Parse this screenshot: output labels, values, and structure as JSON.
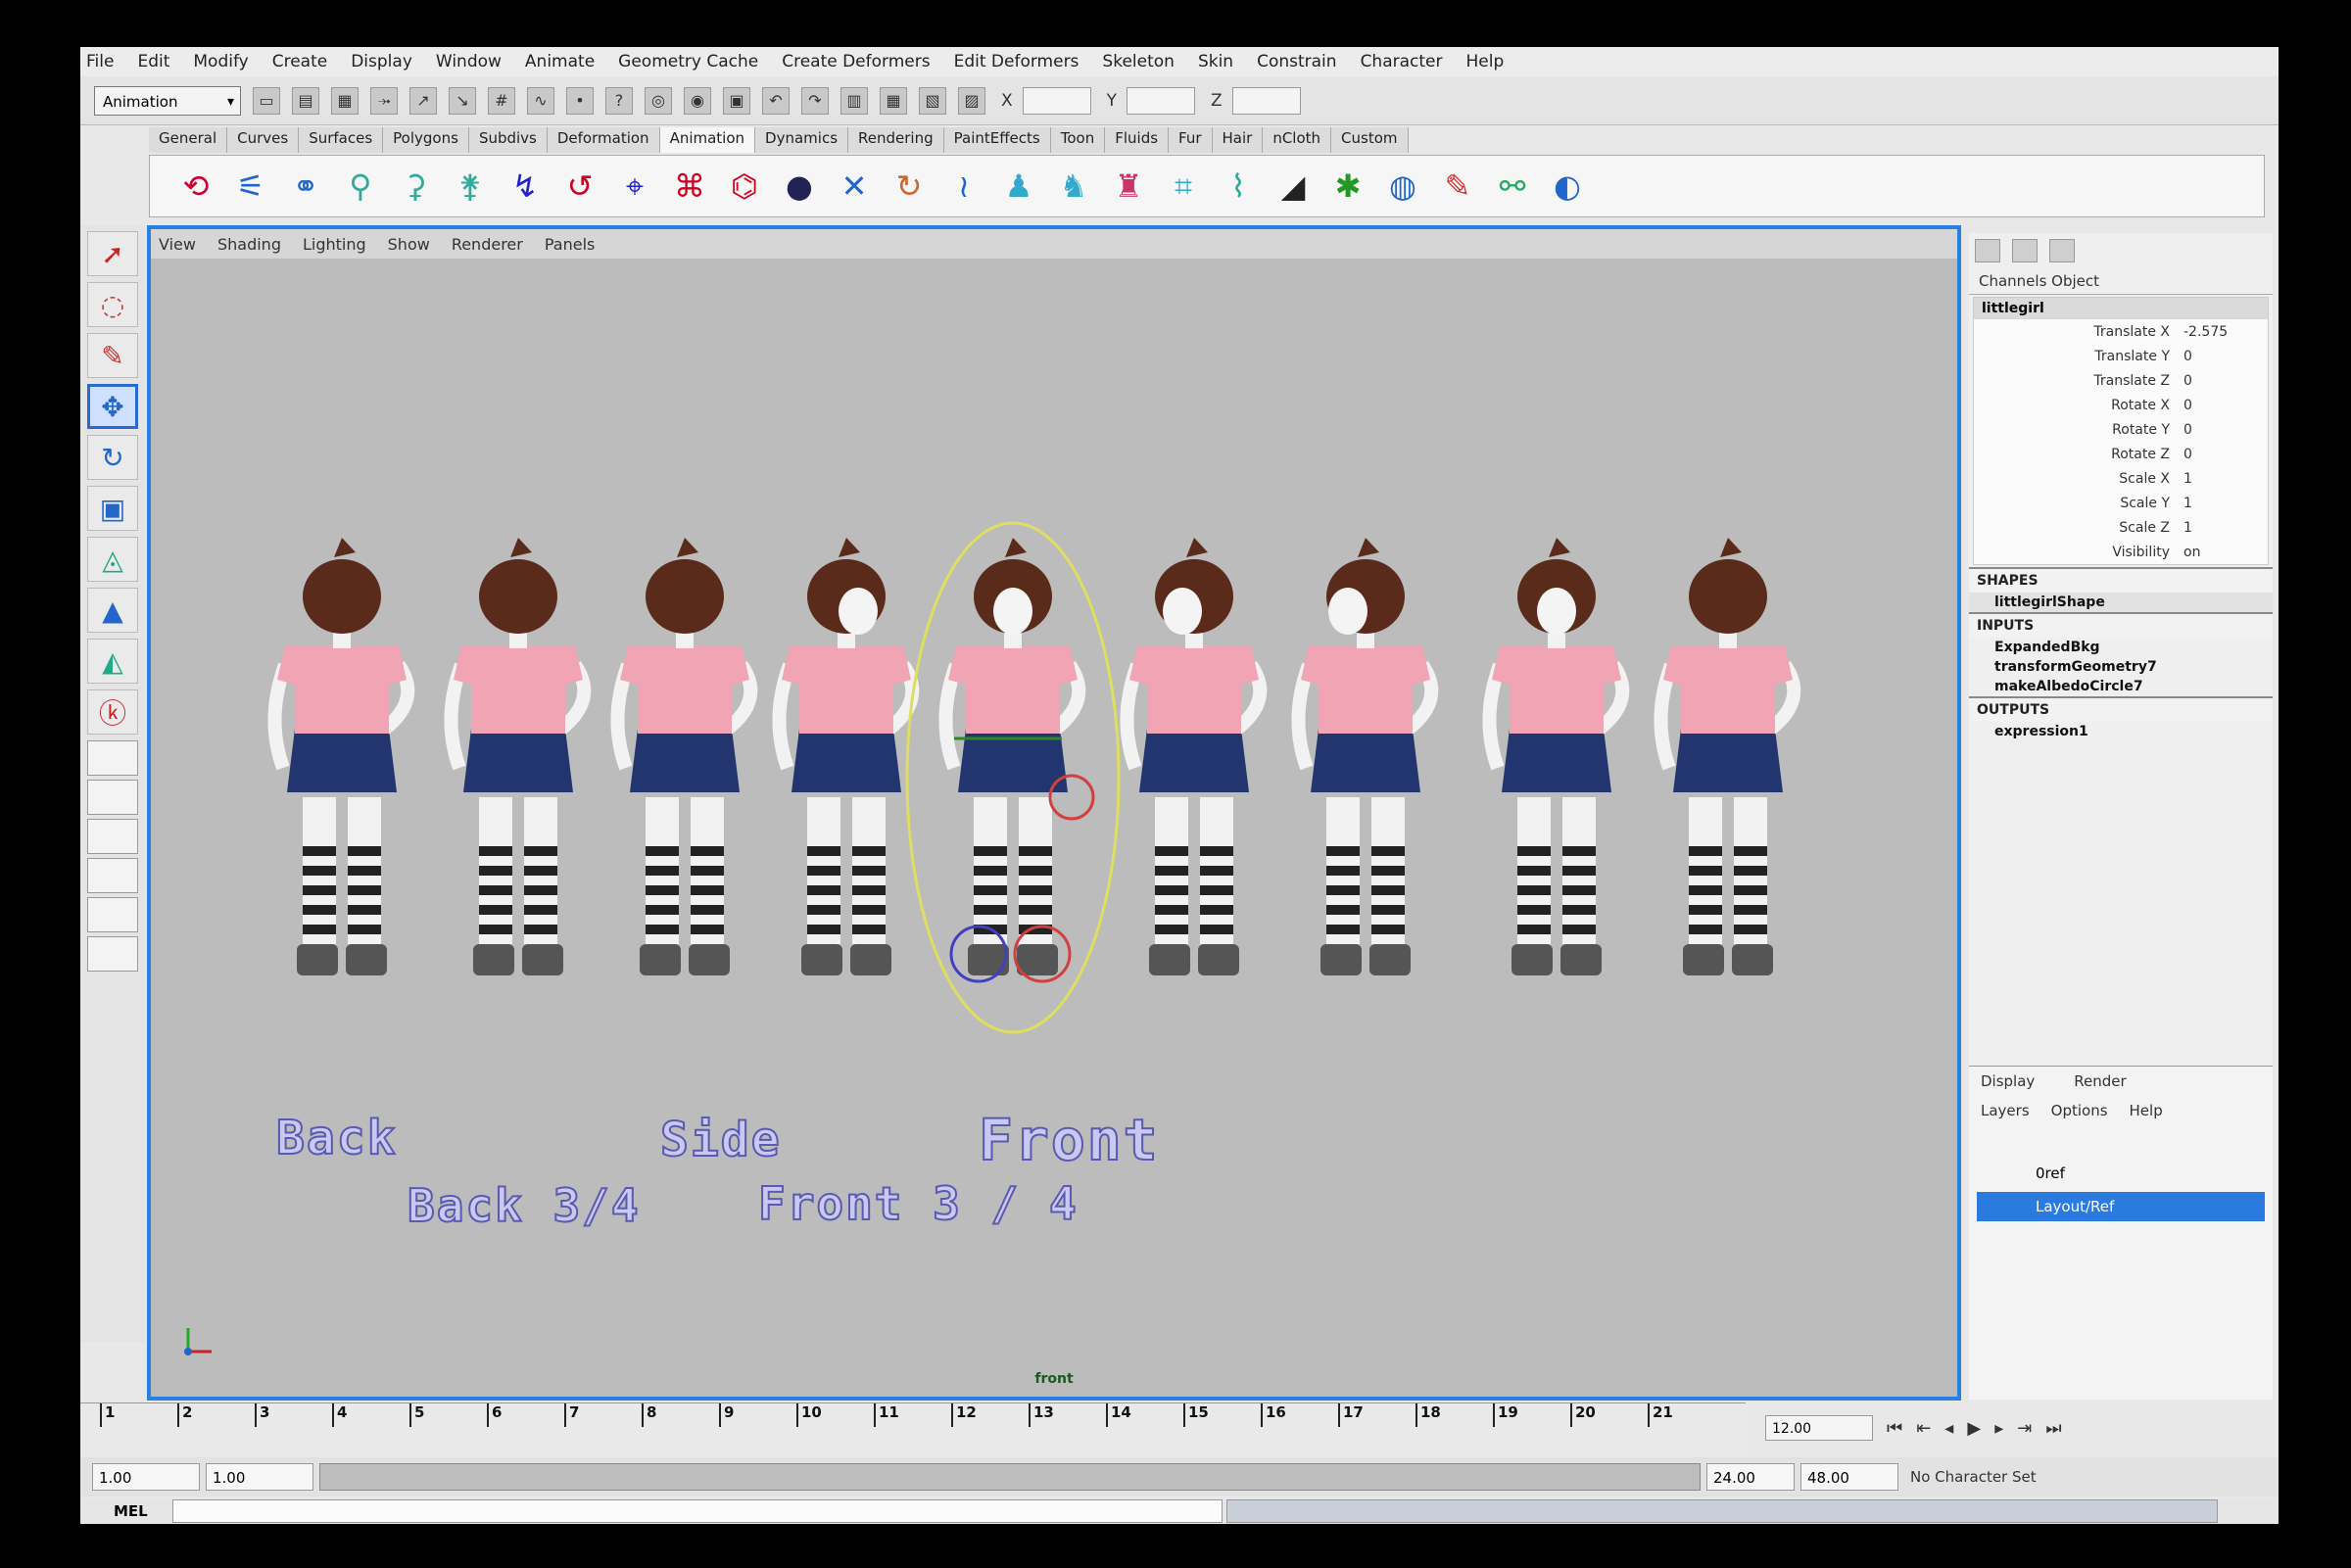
{
  "app": {
    "menus": [
      "File",
      "Edit",
      "Modify",
      "Create",
      "Display",
      "Window",
      "Animate",
      "Geometry Cache",
      "Create Deformers",
      "Edit Deformers",
      "Skeleton",
      "Skin",
      "Constrain",
      "Character",
      "Help"
    ],
    "mode": "Animation",
    "shelf_tabs": [
      "General",
      "Curves",
      "Surfaces",
      "Polygons",
      "Subdivs",
      "Deformation",
      "Animation",
      "Dynamics",
      "Rendering",
      "PaintEffects",
      "Toon",
      "Fluids",
      "Fur",
      "Hair",
      "nCloth",
      "Custom"
    ],
    "active_shelf_tab": "Animation"
  },
  "viewport": {
    "menu": [
      "View",
      "Shading",
      "Lighting",
      "Show",
      "Renderer",
      "Panels"
    ],
    "camera": "front",
    "labels": {
      "back": "Back",
      "side": "Side",
      "front": "Front",
      "back34": "Back 3/4",
      "front34": "Front 3 / 4"
    }
  },
  "channel_box": {
    "tabs": "Channels   Object",
    "object": "littlegirl",
    "attrs": [
      {
        "name": "Translate X",
        "value": "-2.575"
      },
      {
        "name": "Translate Y",
        "value": "0"
      },
      {
        "name": "Translate Z",
        "value": "0"
      },
      {
        "name": "Rotate X",
        "value": "0"
      },
      {
        "name": "Rotate Y",
        "value": "0"
      },
      {
        "name": "Rotate Z",
        "value": "0"
      },
      {
        "name": "Scale X",
        "value": "1"
      },
      {
        "name": "Scale Y",
        "value": "1"
      },
      {
        "name": "Scale Z",
        "value": "1"
      },
      {
        "name": "Visibility",
        "value": "on"
      }
    ],
    "shapes_header": "SHAPES",
    "shape_node": "littlegirlShape",
    "inputs_header": "INPUTS",
    "inputs": [
      "ExpandedBkg",
      "transformGeometry7",
      "makeAlbedoCircle7"
    ],
    "outputs_header": "OUTPUTS",
    "outputs": [
      "expression1"
    ]
  },
  "layer_editor": {
    "modes": [
      "Display",
      "Render"
    ],
    "menu": [
      "Layers",
      "Options",
      "Help"
    ],
    "layers": [
      "0ref",
      "Layout/Ref"
    ]
  },
  "timeline": {
    "ticks": [
      "1",
      "2",
      "3",
      "4",
      "5",
      "6",
      "7",
      "8",
      "9",
      "10",
      "11",
      "12",
      "13",
      "14",
      "15",
      "16",
      "17",
      "18",
      "19",
      "20",
      "21"
    ],
    "current_frame": "12.00",
    "start": "1.00",
    "playback_start": "1.00",
    "playback_end": "24.00",
    "end": "48.00",
    "character_set": "No Character Set"
  },
  "command_line": {
    "label": "MEL"
  },
  "colors": {
    "viewport_bg": "#bcbcbc",
    "viewport_border": "#2a80e0",
    "shirt": "#f0a4b4",
    "skirt": "#22356e",
    "hair": "#5a2a1a",
    "label_fill": "#c8c8f0",
    "label_stroke": "#5a5ab0",
    "selection": "#2a7ae0"
  }
}
